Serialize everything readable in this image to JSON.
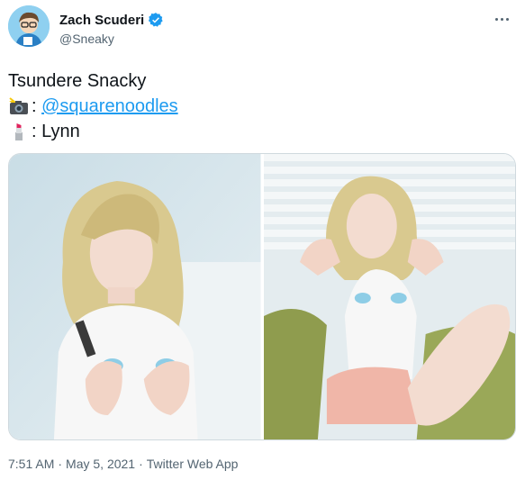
{
  "author": {
    "display_name": "Zach Scuderi",
    "handle": "@Sneaky",
    "verified": true
  },
  "icons": {
    "verified": "verified-badge-icon",
    "more": "more-options-icon",
    "camera": "camera-flash-emoji",
    "lipstick": "lipstick-emoji"
  },
  "tweet": {
    "line1": "Tsundere Snacky",
    "line2_sep": ":",
    "mention": "@squarenoodles",
    "line3_sep": ": Lynn"
  },
  "media": {
    "count": 2
  },
  "meta": {
    "time": "7:51 AM",
    "dot1": "·",
    "date": "May 5, 2021",
    "dot2": "·",
    "source": "Twitter Web App"
  },
  "colors": {
    "accent": "#1d9bf0",
    "text": "#0f1419",
    "secondary": "#536471"
  }
}
